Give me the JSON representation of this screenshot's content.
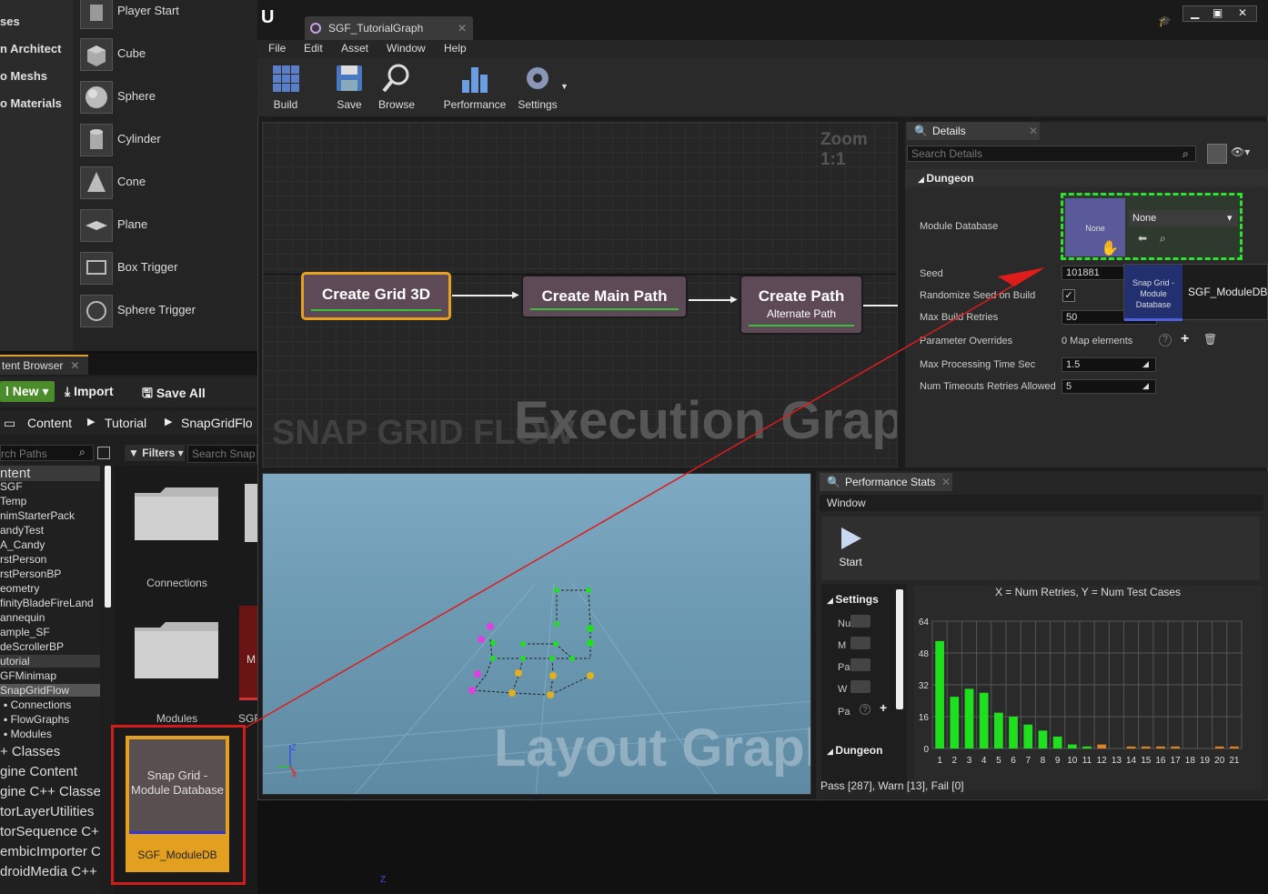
{
  "modes_panel": {
    "categories": [
      "ses",
      "n Architect",
      "o Meshs",
      "o Materials"
    ],
    "items": [
      "Player Start",
      "Cube",
      "Sphere",
      "Cylinder",
      "Cone",
      "Plane",
      "Box Trigger",
      "Sphere Trigger"
    ]
  },
  "content_browser": {
    "tab_label": "tent Browser",
    "new_label": "l New",
    "import_label": "Import",
    "save_all_label": "Save All",
    "path": [
      "Content",
      "Tutorial",
      "SnapGridFlo"
    ],
    "search_paths_placeholder": "rch Paths",
    "filters_label": "Filters",
    "search_assets_placeholder": "Search Snap",
    "tree": [
      "ntent",
      "SGF",
      "Temp",
      "nimStarterPack",
      "andyTest",
      "A_Candy",
      "rstPerson",
      "rstPersonBP",
      "eometry",
      "finityBladeFireLand",
      "annequin",
      "ample_SF",
      "deScrollerBP",
      "utorial",
      "GFMinimap",
      "SnapGridFlow",
      "Connections",
      "FlowGraphs",
      "Modules",
      "+ Classes",
      "gine Content",
      "gine C++ Classe",
      "torLayerUtilities",
      "torSequence C+",
      "embicImporter C",
      "droidMedia C++"
    ],
    "assets": {
      "folder1": "Connections",
      "folder2": "Modules",
      "folder3_partial": "SGF",
      "partial_m": "M",
      "db_thumb_text": "Snap Grid - Module Database",
      "db_name": "SGF_ModuleDB"
    }
  },
  "editor": {
    "tab_title": "SGF_TutorialGraph",
    "menu": [
      "File",
      "Edit",
      "Asset",
      "Window",
      "Help"
    ],
    "toolbar": [
      "Build",
      "Save",
      "Browse",
      "Performance",
      "Settings"
    ],
    "zoom": "Zoom 1:1",
    "watermark_left": "SNAP GRID FLOW",
    "watermark_main": "Execution Graph",
    "nodes": [
      {
        "title": "Create Grid 3D",
        "subtitle": ""
      },
      {
        "title": "Create Main Path",
        "subtitle": ""
      },
      {
        "title": "Create Path",
        "subtitle": "Alternate Path"
      }
    ],
    "layout_watermark": "Layout Graph"
  },
  "details": {
    "tab_label": "Details",
    "search_placeholder": "Search Details",
    "section": "Dungeon",
    "rows": [
      {
        "label": "Module Database",
        "value": ""
      },
      {
        "label": "Seed",
        "value": "101881"
      },
      {
        "label": "Randomize Seed on Build",
        "value": ""
      },
      {
        "label": "Max Build Retries",
        "value": "50"
      },
      {
        "label": "Parameter Overrides",
        "value": "0 Map elements"
      },
      {
        "label": "Max Processing Time Sec",
        "value": "1.5"
      },
      {
        "label": "Num Timeouts Retries Allowed",
        "value": "5"
      }
    ],
    "module_db_thumb": "None",
    "module_db_dropdown": "None",
    "tooltip_thumb": "Snap Grid - Module Database",
    "tooltip_name": "SGF_ModuleDB"
  },
  "performance": {
    "tab_label": "Performance Stats",
    "window_label": "Window",
    "start_label": "Start",
    "settings_label": "Settings",
    "settings_rows": [
      "Nu",
      "M",
      "Pa",
      "W",
      "Pa"
    ],
    "dungeon_label": "Dungeon",
    "status": "Pass [287], Warn [13], Fail [0]"
  },
  "chart_data": {
    "type": "bar",
    "title": "X = Num Retries, Y = Num Test Cases",
    "categories": [
      "1",
      "2",
      "3",
      "4",
      "5",
      "6",
      "7",
      "8",
      "9",
      "10",
      "11",
      "12",
      "13",
      "14",
      "15",
      "16",
      "17",
      "18",
      "19",
      "20",
      "21"
    ],
    "series": [
      {
        "values": [
          54,
          26,
          30,
          28,
          18,
          16,
          12,
          9,
          6,
          2,
          1,
          0,
          0,
          0,
          0,
          0,
          0,
          0,
          0,
          0,
          0
        ],
        "color": "#1ee01e"
      },
      {
        "values": [
          0,
          0,
          0,
          0,
          0,
          0,
          0,
          0,
          0,
          0,
          0,
          2,
          0,
          1,
          1,
          1,
          1,
          0,
          0,
          1,
          1
        ],
        "color": "#e08020"
      }
    ],
    "yticks": [
      "64",
      "48",
      "32",
      "16",
      "0"
    ],
    "ylim": [
      0,
      64
    ]
  }
}
